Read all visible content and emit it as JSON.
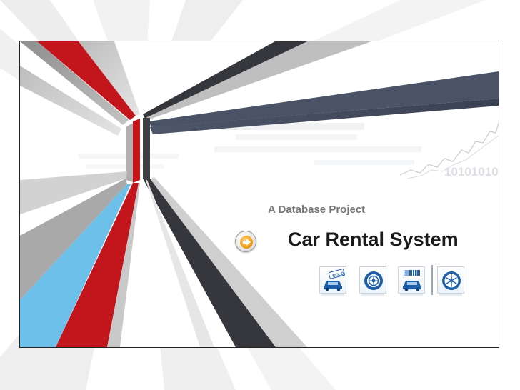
{
  "slide": {
    "subtitle": "A Database Project",
    "title": "Car Rental System"
  },
  "icons": [
    {
      "name": "car-sold-icon",
      "label": "SOLD"
    },
    {
      "name": "tire-wheel-icon"
    },
    {
      "name": "car-barcode-icon"
    },
    {
      "name": "snowflake-tire-icon"
    }
  ],
  "decorations": {
    "binary_text": "10101010",
    "colors": {
      "red_ray": "#c3161c",
      "dark_ray": "#3b3d42",
      "navy_ray": "#434b5e",
      "blue_ray": "#6cc0ea",
      "grey_ray": "#b9b9b9",
      "accent_orange": "#f5a21f",
      "icon_blue": "#1f5fa8"
    }
  }
}
